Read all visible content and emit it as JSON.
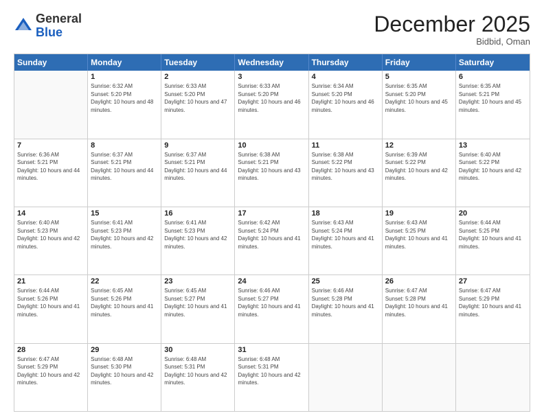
{
  "header": {
    "logo_general": "General",
    "logo_blue": "Blue",
    "month_title": "December 2025",
    "location": "Bidbid, Oman"
  },
  "weekdays": [
    "Sunday",
    "Monday",
    "Tuesday",
    "Wednesday",
    "Thursday",
    "Friday",
    "Saturday"
  ],
  "weeks": [
    [
      {
        "day": "",
        "sunrise": "",
        "sunset": "",
        "daylight": ""
      },
      {
        "day": "1",
        "sunrise": "Sunrise: 6:32 AM",
        "sunset": "Sunset: 5:20 PM",
        "daylight": "Daylight: 10 hours and 48 minutes."
      },
      {
        "day": "2",
        "sunrise": "Sunrise: 6:33 AM",
        "sunset": "Sunset: 5:20 PM",
        "daylight": "Daylight: 10 hours and 47 minutes."
      },
      {
        "day": "3",
        "sunrise": "Sunrise: 6:33 AM",
        "sunset": "Sunset: 5:20 PM",
        "daylight": "Daylight: 10 hours and 46 minutes."
      },
      {
        "day": "4",
        "sunrise": "Sunrise: 6:34 AM",
        "sunset": "Sunset: 5:20 PM",
        "daylight": "Daylight: 10 hours and 46 minutes."
      },
      {
        "day": "5",
        "sunrise": "Sunrise: 6:35 AM",
        "sunset": "Sunset: 5:20 PM",
        "daylight": "Daylight: 10 hours and 45 minutes."
      },
      {
        "day": "6",
        "sunrise": "Sunrise: 6:35 AM",
        "sunset": "Sunset: 5:21 PM",
        "daylight": "Daylight: 10 hours and 45 minutes."
      }
    ],
    [
      {
        "day": "7",
        "sunrise": "Sunrise: 6:36 AM",
        "sunset": "Sunset: 5:21 PM",
        "daylight": "Daylight: 10 hours and 44 minutes."
      },
      {
        "day": "8",
        "sunrise": "Sunrise: 6:37 AM",
        "sunset": "Sunset: 5:21 PM",
        "daylight": "Daylight: 10 hours and 44 minutes."
      },
      {
        "day": "9",
        "sunrise": "Sunrise: 6:37 AM",
        "sunset": "Sunset: 5:21 PM",
        "daylight": "Daylight: 10 hours and 44 minutes."
      },
      {
        "day": "10",
        "sunrise": "Sunrise: 6:38 AM",
        "sunset": "Sunset: 5:21 PM",
        "daylight": "Daylight: 10 hours and 43 minutes."
      },
      {
        "day": "11",
        "sunrise": "Sunrise: 6:38 AM",
        "sunset": "Sunset: 5:22 PM",
        "daylight": "Daylight: 10 hours and 43 minutes."
      },
      {
        "day": "12",
        "sunrise": "Sunrise: 6:39 AM",
        "sunset": "Sunset: 5:22 PM",
        "daylight": "Daylight: 10 hours and 42 minutes."
      },
      {
        "day": "13",
        "sunrise": "Sunrise: 6:40 AM",
        "sunset": "Sunset: 5:22 PM",
        "daylight": "Daylight: 10 hours and 42 minutes."
      }
    ],
    [
      {
        "day": "14",
        "sunrise": "Sunrise: 6:40 AM",
        "sunset": "Sunset: 5:23 PM",
        "daylight": "Daylight: 10 hours and 42 minutes."
      },
      {
        "day": "15",
        "sunrise": "Sunrise: 6:41 AM",
        "sunset": "Sunset: 5:23 PM",
        "daylight": "Daylight: 10 hours and 42 minutes."
      },
      {
        "day": "16",
        "sunrise": "Sunrise: 6:41 AM",
        "sunset": "Sunset: 5:23 PM",
        "daylight": "Daylight: 10 hours and 42 minutes."
      },
      {
        "day": "17",
        "sunrise": "Sunrise: 6:42 AM",
        "sunset": "Sunset: 5:24 PM",
        "daylight": "Daylight: 10 hours and 41 minutes."
      },
      {
        "day": "18",
        "sunrise": "Sunrise: 6:43 AM",
        "sunset": "Sunset: 5:24 PM",
        "daylight": "Daylight: 10 hours and 41 minutes."
      },
      {
        "day": "19",
        "sunrise": "Sunrise: 6:43 AM",
        "sunset": "Sunset: 5:25 PM",
        "daylight": "Daylight: 10 hours and 41 minutes."
      },
      {
        "day": "20",
        "sunrise": "Sunrise: 6:44 AM",
        "sunset": "Sunset: 5:25 PM",
        "daylight": "Daylight: 10 hours and 41 minutes."
      }
    ],
    [
      {
        "day": "21",
        "sunrise": "Sunrise: 6:44 AM",
        "sunset": "Sunset: 5:26 PM",
        "daylight": "Daylight: 10 hours and 41 minutes."
      },
      {
        "day": "22",
        "sunrise": "Sunrise: 6:45 AM",
        "sunset": "Sunset: 5:26 PM",
        "daylight": "Daylight: 10 hours and 41 minutes."
      },
      {
        "day": "23",
        "sunrise": "Sunrise: 6:45 AM",
        "sunset": "Sunset: 5:27 PM",
        "daylight": "Daylight: 10 hours and 41 minutes."
      },
      {
        "day": "24",
        "sunrise": "Sunrise: 6:46 AM",
        "sunset": "Sunset: 5:27 PM",
        "daylight": "Daylight: 10 hours and 41 minutes."
      },
      {
        "day": "25",
        "sunrise": "Sunrise: 6:46 AM",
        "sunset": "Sunset: 5:28 PM",
        "daylight": "Daylight: 10 hours and 41 minutes."
      },
      {
        "day": "26",
        "sunrise": "Sunrise: 6:47 AM",
        "sunset": "Sunset: 5:28 PM",
        "daylight": "Daylight: 10 hours and 41 minutes."
      },
      {
        "day": "27",
        "sunrise": "Sunrise: 6:47 AM",
        "sunset": "Sunset: 5:29 PM",
        "daylight": "Daylight: 10 hours and 41 minutes."
      }
    ],
    [
      {
        "day": "28",
        "sunrise": "Sunrise: 6:47 AM",
        "sunset": "Sunset: 5:29 PM",
        "daylight": "Daylight: 10 hours and 42 minutes."
      },
      {
        "day": "29",
        "sunrise": "Sunrise: 6:48 AM",
        "sunset": "Sunset: 5:30 PM",
        "daylight": "Daylight: 10 hours and 42 minutes."
      },
      {
        "day": "30",
        "sunrise": "Sunrise: 6:48 AM",
        "sunset": "Sunset: 5:31 PM",
        "daylight": "Daylight: 10 hours and 42 minutes."
      },
      {
        "day": "31",
        "sunrise": "Sunrise: 6:48 AM",
        "sunset": "Sunset: 5:31 PM",
        "daylight": "Daylight: 10 hours and 42 minutes."
      },
      {
        "day": "",
        "sunrise": "",
        "sunset": "",
        "daylight": ""
      },
      {
        "day": "",
        "sunrise": "",
        "sunset": "",
        "daylight": ""
      },
      {
        "day": "",
        "sunrise": "",
        "sunset": "",
        "daylight": ""
      }
    ]
  ]
}
